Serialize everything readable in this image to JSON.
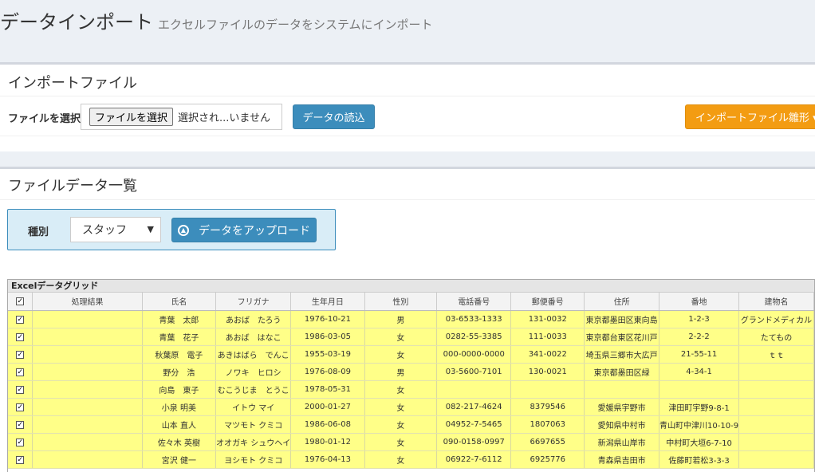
{
  "header": {
    "title": "データインポート",
    "subtitle": "エクセルファイルのデータをシステムにインポート"
  },
  "import_box": {
    "title": "インポートファイル",
    "file_label": "ファイルを選択",
    "file_button": "ファイルを選択",
    "file_status": "選択され...いません",
    "read_button": "データの読込",
    "template_button": "インポートファイル雛形 ▾",
    "colors": {
      "primary": "#3c8dbc",
      "warning": "#f39c12"
    }
  },
  "list_box": {
    "title": "ファイルデータ一覧",
    "type_label": "種別",
    "type_value": "スタッフ",
    "upload_button": "データをアップロード",
    "upload_icon": "arrow-up-circle-icon"
  },
  "grid": {
    "caption": "Excelデータグリッド",
    "columns": [
      "",
      "処理結果",
      "氏名",
      "フリガナ",
      "生年月日",
      "性別",
      "電話番号",
      "郵便番号",
      "住所",
      "番地",
      "建物名"
    ],
    "rows": [
      [
        "",
        "青葉　太郎",
        "あおば　たろう",
        "1976-10-21",
        "男",
        "03-6533-1333",
        "131-0032",
        "東京都墨田区東向島",
        "1-2-3",
        "グランドメディカル"
      ],
      [
        "",
        "青葉　花子",
        "あおば　はなこ",
        "1986-03-05",
        "女",
        "0282-55-3385",
        "111-0033",
        "東京都台東区花川戸",
        "2-2-2",
        "たてもの"
      ],
      [
        "",
        "秋葉原　電子",
        "あきはばら　でんこ",
        "1955-03-19",
        "女",
        "000-0000-0000",
        "341-0022",
        "埼玉県三郷市大広戸",
        "21-55-11",
        "ｔｔ"
      ],
      [
        "",
        "野分　浩",
        "ノワキ　ヒロシ",
        "1976-08-09",
        "男",
        "03-5600-7101",
        "130-0021",
        "東京都墨田区緑",
        "4-34-1",
        ""
      ],
      [
        "",
        "向島　東子",
        "むこうじま　とうこ",
        "1978-05-31",
        "女",
        "",
        "",
        "",
        "",
        ""
      ],
      [
        "",
        "小泉 明美",
        "イトウ マイ",
        "2000-01-27",
        "女",
        "082-217-4624",
        "8379546",
        "愛媛県宇野市",
        "津田町宇野9-8-1",
        ""
      ],
      [
        "",
        "山本 直人",
        "マツモト クミコ",
        "1986-06-08",
        "女",
        "04952-7-5465",
        "1807063",
        "愛知県中村市",
        "青山町中津川10-10-9",
        ""
      ],
      [
        "",
        "佐々木 英樹",
        "オオガキ シュウヘイ",
        "1980-01-12",
        "女",
        "090-0158-0997",
        "6697655",
        "新潟県山岸市",
        "中村町大垣6-7-10",
        ""
      ],
      [
        "",
        "宮沢 健一",
        "ヨシモト クミコ",
        "1976-04-13",
        "女",
        "06922-7-6112",
        "6925776",
        "青森県吉田市",
        "佐藤町若松3-3-3",
        ""
      ]
    ]
  }
}
